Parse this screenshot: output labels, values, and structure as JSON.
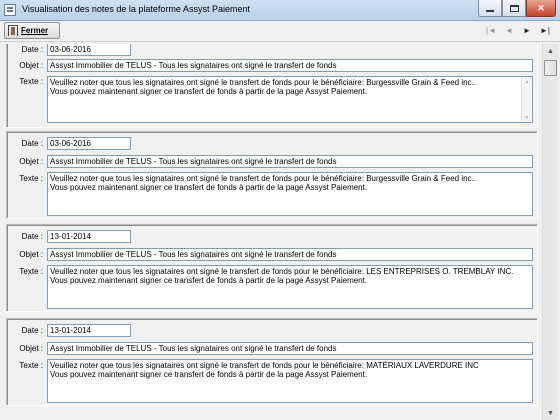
{
  "window": {
    "title": "Visualisation des notes de la plateforme Assyst Paiement",
    "minimize_icon": "minimize-icon",
    "maximize_icon": "maximize-icon",
    "close_glyph": "✕"
  },
  "toolbar": {
    "fermer_label": "Fermer",
    "fermer_icon": "door-exit-icon",
    "nav": {
      "first": "|◄",
      "prev": "◄",
      "next": "►",
      "last": "►|"
    }
  },
  "labels": {
    "date": "Date :",
    "objet": "Objet :",
    "texte": "Texte :"
  },
  "records": [
    {
      "date": "03-06-2016",
      "objet": "Assyst Immobilier de TELUS - Tous les signataires ont signé le transfert de fonds",
      "texte_line1": "Veuillez noter que tous les signataires ont signé le transfert de fonds pour le bénéficiaire: Burgessville Grain & Feed inc..",
      "texte_line2": "Vous pouvez maintenant signer ce transfert de fonds à partir de la page Assyst Paiement."
    },
    {
      "date": "03-06-2016",
      "objet": "Assyst Immobilier de TELUS - Tous les signataires ont signé le transfert de fonds",
      "texte_line1": "Veuillez noter que tous les signataires ont signé le transfert de fonds pour le bénéficiaire: Burgessville Grain & Feed inc..",
      "texte_line2": "Vous pouvez maintenant signer ce transfert de fonds à partir de la page Assyst Paiement."
    },
    {
      "date": "13-01-2014",
      "objet": "Assyst Immobilier de TELUS - Tous les signataires ont signé le transfert de fonds",
      "texte_line1": "Veuillez noter que tous les signataires ont signé le transfert de fonds pour le bénéficiaire: LES ENTREPRISES O. TREMBLAY INC.",
      "texte_line2": "Vous pouvez maintenant signer ce transfert de fonds à partir de la page Assyst Paiement."
    },
    {
      "date": "13-01-2014",
      "objet": "Assyst Immobilier de TELUS - Tous les signataires ont signé le transfert de fonds",
      "texte_line1": "Veuillez noter que tous les signataires ont signé le transfert de fonds pour le bénéficiaire: MATÉRIAUX LAVERDURE INC",
      "texte_line2": "Vous pouvez maintenant signer ce transfert de fonds à partir de la page Assyst Paiement."
    }
  ],
  "scrollbar": {
    "up": "▲",
    "down": "▼"
  }
}
